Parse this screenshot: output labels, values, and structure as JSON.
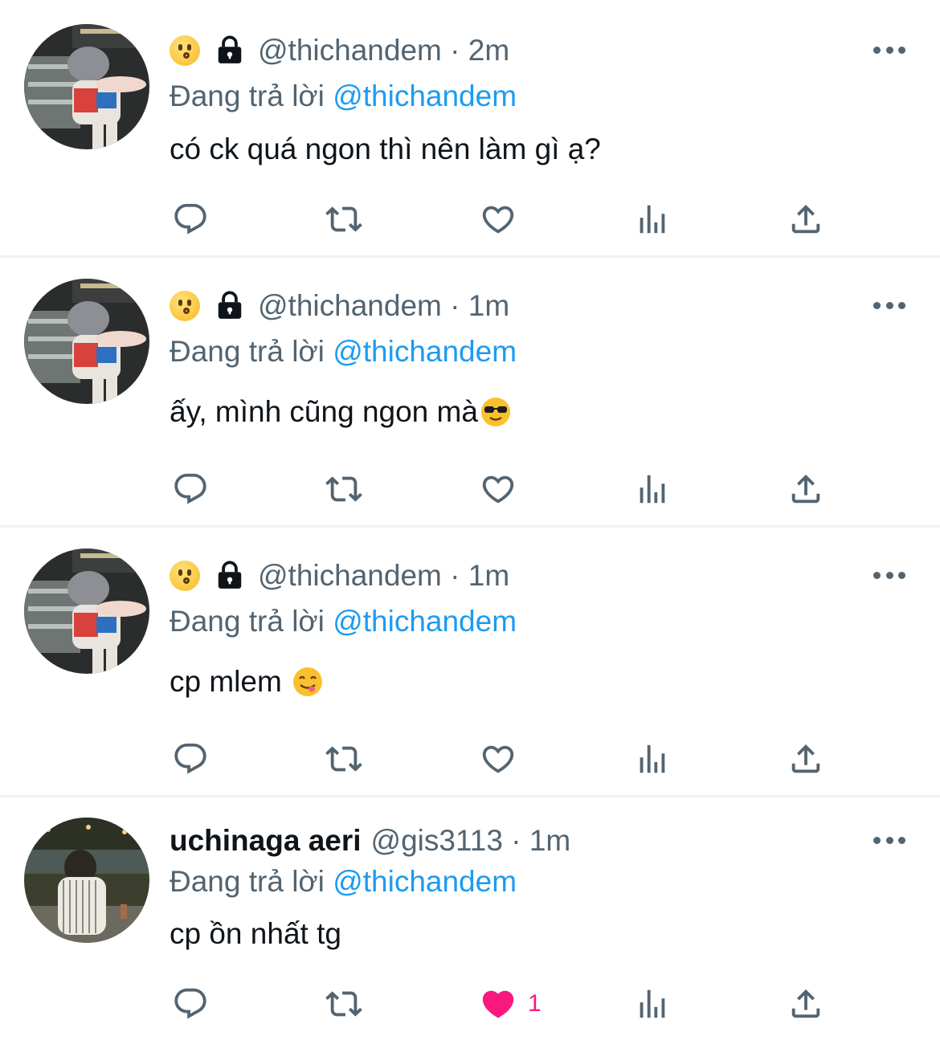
{
  "colors": {
    "text": "#0f1419",
    "secondary": "#536471",
    "link": "#1d9bf0",
    "like": "#f91880",
    "separator": "#eff3f4"
  },
  "icons": [
    "face-emoji-icon",
    "lock-icon",
    "more-icon",
    "reply-icon",
    "retweet-icon",
    "like-icon",
    "views-icon",
    "share-icon"
  ],
  "replying_prefix": "Đang trả lời",
  "tweets": [
    {
      "display_name": "",
      "handle": "@thichandem",
      "time": "2m",
      "reply_to": "@thichandem",
      "text": "có ck quá ngon thì nên làm gì ạ?",
      "text_emoji": "",
      "liked": false,
      "like_count": ""
    },
    {
      "display_name": "",
      "handle": "@thichandem",
      "time": "1m",
      "reply_to": "@thichandem",
      "text": "ấy, mình cũng ngon mà",
      "text_emoji": "sunglasses-emoji-icon",
      "liked": false,
      "like_count": ""
    },
    {
      "display_name": "",
      "handle": "@thichandem",
      "time": "1m",
      "reply_to": "@thichandem",
      "text": "cp mlem ",
      "text_emoji": "yum-emoji-icon",
      "liked": false,
      "like_count": ""
    },
    {
      "display_name": "uchinaga aeri",
      "handle": "@gis3113",
      "time": "1m",
      "reply_to": "@thichandem",
      "text": "cp ồn nhất tg",
      "text_emoji": "",
      "liked": true,
      "like_count": "1"
    }
  ]
}
